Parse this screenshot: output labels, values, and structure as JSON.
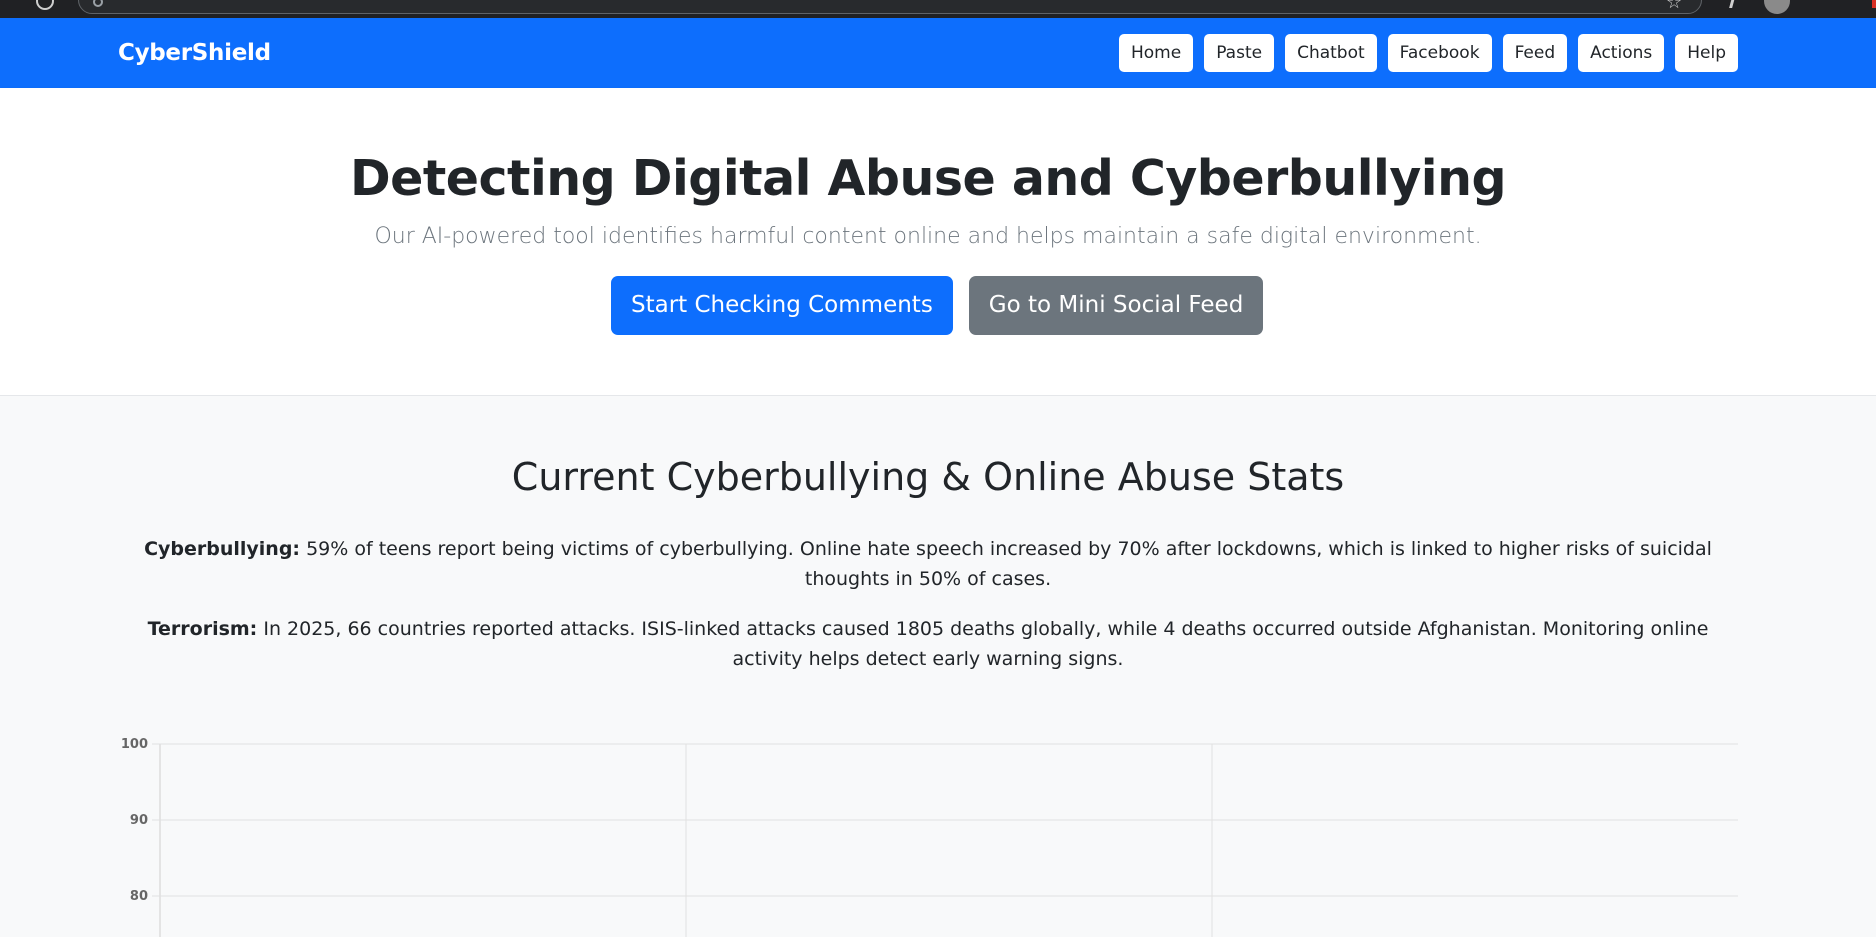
{
  "navbar": {
    "brand": "CyberShield",
    "links": [
      "Home",
      "Paste",
      "Chatbot",
      "Facebook",
      "Feed",
      "Actions",
      "Help"
    ],
    "colors": {
      "background": "#0d6efd",
      "button": "#ffffff"
    }
  },
  "hero": {
    "title": "Detecting Digital Abuse and Cyberbullying",
    "subtitle": "Our AI-powered tool identifies harmful content online and helps maintain a safe digital environment.",
    "primary_button": "Start Checking Comments",
    "secondary_button": "Go to Mini Social Feed",
    "colors": {
      "primary": "#0d6efd",
      "secondary": "#6c757d"
    }
  },
  "stats": {
    "title": "Current Cyberbullying & Online Abuse Stats",
    "cyberbullying": {
      "label": "Cyberbullying:",
      "text": "59% of teens report being victims of cyberbullying. Online hate speech increased by 70% after lockdowns, which is linked to higher risks of suicidal thoughts in 50% of cases."
    },
    "terrorism": {
      "label": "Terrorism:",
      "text": "In 2025, 66 countries reported attacks. ISIS-linked attacks caused 1805 deaths globally, while 4 deaths occurred outside Afghanistan. Monitoring online activity helps detect early warning signs."
    }
  },
  "chart_data": {
    "type": "bar",
    "title": "",
    "categories": [],
    "series": [],
    "ylim_visible": [
      80,
      100
    ],
    "y_ticks": [
      "100",
      "90",
      "80"
    ],
    "x_gridlines": 3,
    "grid": true
  }
}
